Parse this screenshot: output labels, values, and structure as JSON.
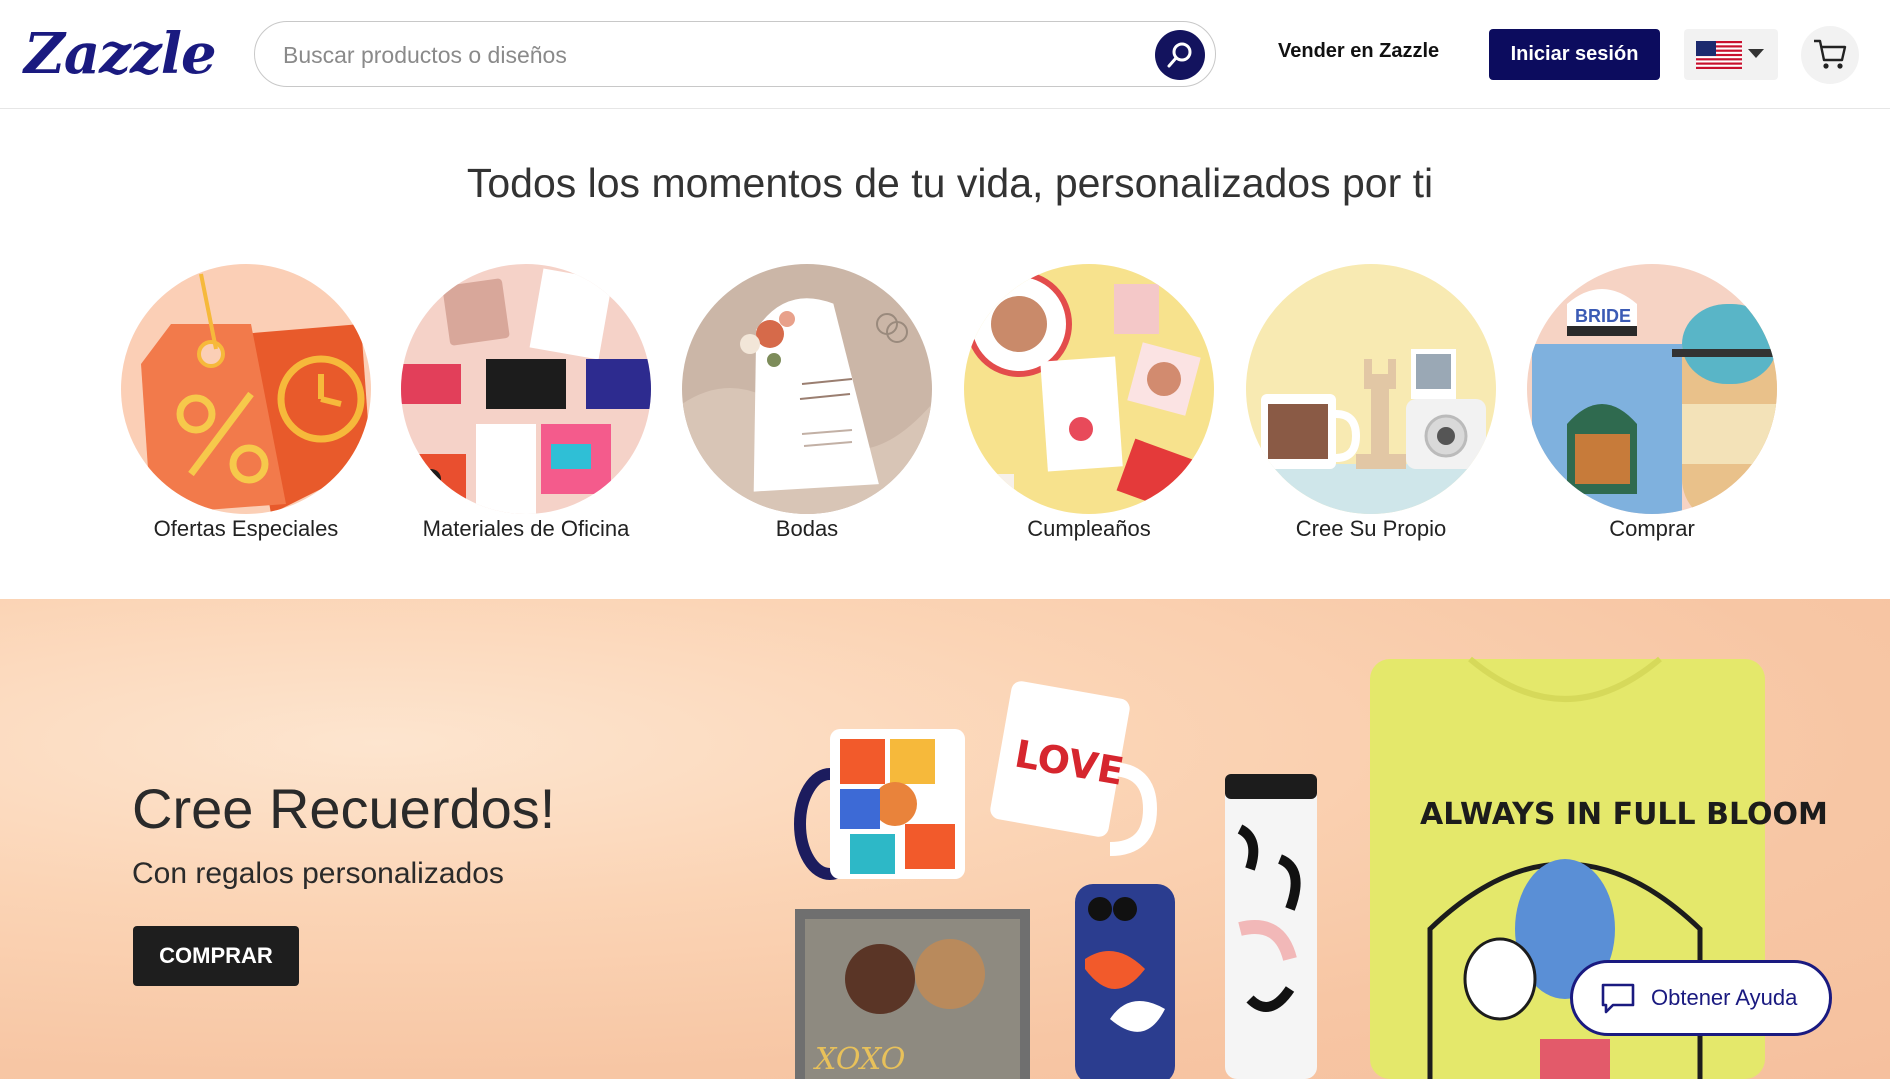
{
  "header": {
    "logo_text": "Zazzle",
    "search_placeholder": "Buscar productos o diseños",
    "sell_label": "Vender en Zazzle",
    "login_label": "Iniciar sesión",
    "locale_flag": "us-flag-icon",
    "cart_icon": "cart-icon"
  },
  "headline": "Todos los momentos de tu vida, personalizados por ti",
  "categories": [
    {
      "label": "Ofertas Especiales"
    },
    {
      "label": "Materiales de Oficina"
    },
    {
      "label": "Bodas"
    },
    {
      "label": "Cumpleaños"
    },
    {
      "label": "Cree Su Propio"
    },
    {
      "label": "Comprar"
    }
  ],
  "hero": {
    "title": "Cree Recuerdos!",
    "subtitle": "Con regalos personalizados",
    "button_label": "COMPRAR",
    "mug_text": "LOVE",
    "shirt_text": "ALWAYS IN FULL BLOOM",
    "photo_text": "XOXO"
  },
  "help": {
    "label": "Obtener Ayuda"
  },
  "colors": {
    "brand": "#1a1a80",
    "login_bg": "#0c0c5e",
    "hero_bg": "#f7c6a4"
  }
}
